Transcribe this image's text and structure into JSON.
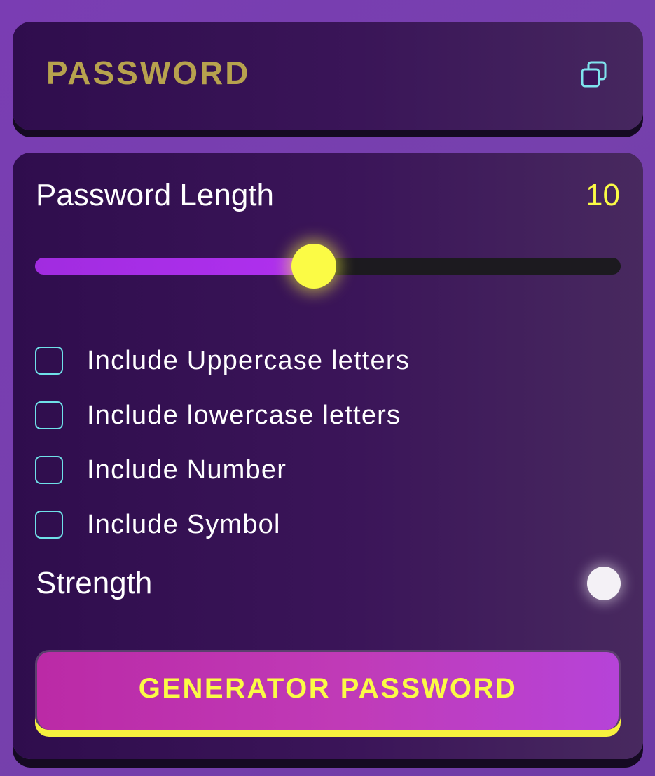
{
  "display": {
    "password": "PASSWORD",
    "copy_icon": "copy-icon"
  },
  "length": {
    "label": "Password Length",
    "value": "10",
    "slider_fraction": 0.476
  },
  "options": [
    {
      "label": "Include Uppercase letters",
      "checked": false
    },
    {
      "label": "Include lowercase letters",
      "checked": false
    },
    {
      "label": "Include Number",
      "checked": false
    },
    {
      "label": "Include Symbol",
      "checked": false
    }
  ],
  "strength": {
    "label": "Strength",
    "indicator_color": "#f4f1f6"
  },
  "generate": {
    "label": "GENERATOR PASSWORD"
  },
  "colors": {
    "accent_yellow": "#fbfb45",
    "password_gold": "#b7a24e",
    "checkbox_cyan": "#6fe0e8",
    "slider_purple": "#b030ef"
  }
}
